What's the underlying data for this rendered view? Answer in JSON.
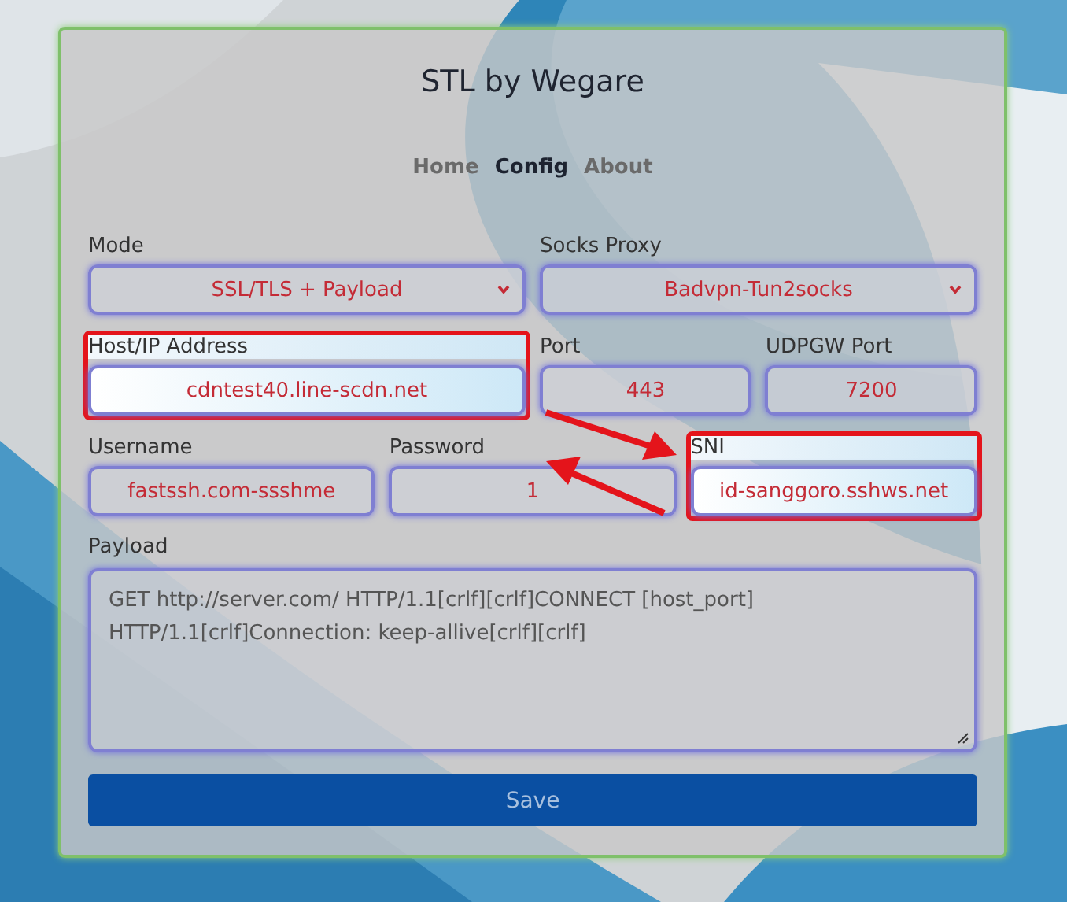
{
  "title": "STL by Wegare",
  "nav": [
    {
      "label": "Home",
      "selected": false
    },
    {
      "label": "Config",
      "selected": true
    },
    {
      "label": "About",
      "selected": false
    }
  ],
  "rows": [
    [
      {
        "label": "Mode",
        "kind": "select",
        "value": "SSL/TLS + Payload",
        "highlighted": false
      },
      {
        "label": "Socks Proxy",
        "kind": "select",
        "value": "Badvpn-Tun2socks",
        "highlighted": false
      }
    ],
    [
      {
        "label": "Host/IP Address",
        "kind": "input",
        "value": "cdntest40.line-scdn.net",
        "highlighted": true
      },
      {
        "label": "Port",
        "kind": "input",
        "value": "443",
        "highlighted": false
      },
      {
        "label": "UDPGW Port",
        "kind": "input",
        "value": "7200",
        "highlighted": false
      }
    ],
    [
      {
        "label": "Username",
        "kind": "input",
        "value": "fastssh.com-ssshme",
        "highlighted": false
      },
      {
        "label": "Password",
        "kind": "input",
        "value": "1",
        "highlighted": false
      },
      {
        "label": "SNI",
        "kind": "input",
        "value": "id-sanggoro.sshws.net",
        "highlighted": true
      }
    ]
  ],
  "payload": {
    "label": "Payload",
    "value": "GET http://server.com/ HTTP/1.1[crlf][crlf]CONNECT [host_port] HTTP/1.1[crlf]Connection: keep-allive[crlf][crlf]"
  },
  "save_button": "Save"
}
